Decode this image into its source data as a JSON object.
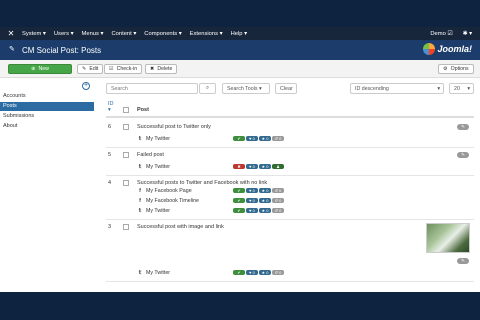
{
  "topnav": {
    "menu": [
      "System ▾",
      "Users ▾",
      "Menus ▾",
      "Content ▾",
      "Components ▾",
      "Extensions ▾",
      "Help ▾"
    ],
    "user": "Demo ☑",
    "settings": "✱ ▾"
  },
  "header": {
    "title": "CM Social Post: Posts",
    "brand": "Joomla!"
  },
  "toolbar": {
    "new": "New",
    "edit": "Edit",
    "checkin": "Check-in",
    "delete": "Delete",
    "options": "Options"
  },
  "sidebar": {
    "items": [
      "Accounts",
      "Posts",
      "Submissions",
      "About"
    ],
    "active": 1
  },
  "filters": {
    "search_placeholder": "Search",
    "search_tools": "Search Tools ▾",
    "clear": "Clear",
    "ordering": "ID descending",
    "limit": "20"
  },
  "table": {
    "id_header": "ID",
    "sort_arrow": "▾",
    "post_header": "Post"
  },
  "rows": [
    {
      "id": "6",
      "title": "Successful post to Twitter only",
      "channels": [
        {
          "icon": "twitter-icon",
          "name": "My Twitter",
          "badges": [
            "✔",
            "♥ 0",
            "★ 0",
            "↺ 0"
          ]
        }
      ]
    },
    {
      "id": "5",
      "title": "Failed post",
      "channels": [
        {
          "icon": "twitter-icon",
          "name": "My Twitter",
          "badges": [
            "✖",
            "♥ 0",
            "★ 0",
            "♟"
          ]
        }
      ]
    },
    {
      "id": "4",
      "title": "Successful posts to Twitter and Facebook with no link",
      "channels": [
        {
          "icon": "facebook-icon",
          "name": "My Facebook Page",
          "badges": [
            "✔",
            "♥ 0",
            "★ 0",
            "↺ 0"
          ]
        },
        {
          "icon": "facebook-icon",
          "name": "My Facebook Timeline",
          "badges": [
            "✔",
            "♥ 0",
            "★ 0",
            "↺ 0"
          ]
        },
        {
          "icon": "twitter-icon",
          "name": "My Twitter",
          "badges": [
            "✔",
            "♥ 0",
            "★ 0",
            "↺ 0"
          ]
        }
      ]
    },
    {
      "id": "3",
      "title": "Successful post with image and link",
      "channels": [
        {
          "icon": "twitter-icon",
          "name": "My Twitter",
          "badges": [
            "✔",
            "♥ 0",
            "★ 0",
            "↺ 0"
          ]
        }
      ]
    }
  ],
  "pill_label": "✎",
  "colors": {
    "nav": "#17263b",
    "header": "#1c3d6b",
    "accent": "#2d6ca2",
    "new_button": "#46a546"
  }
}
